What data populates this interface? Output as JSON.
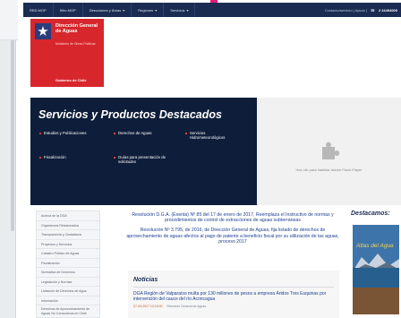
{
  "colors": {
    "navbar": "#1a2c52",
    "brand_red": "#d7272d",
    "banner": "#0e1d3a",
    "accent_bullet": "#e8412c",
    "link": "#1d3f8f"
  },
  "topnav": {
    "items": [
      {
        "label": "RED MOP",
        "caret": false
      },
      {
        "label": "Sitio MOP",
        "caret": false
      },
      {
        "label": "Direcciones y Áreas",
        "caret": true
      },
      {
        "label": "Regiones",
        "caret": true
      },
      {
        "label": "Servicios",
        "caret": true
      }
    ],
    "right_text": "Contacto/servicio | Ayuda |",
    "phone_icon": "phone-icon",
    "phone": "2 24494000"
  },
  "logo": {
    "title": "Dirección General de Aguas",
    "subtitle": "Ministerio de Obras Públicas",
    "gov": "Gobierno de Chile",
    "icon": "chile-star-icon"
  },
  "services": {
    "title": "Servicios y Productos Destacados",
    "items": [
      "Estudios y Publicaciones",
      "Derechos de Aguas",
      "Servicios Hidrometeorológicos",
      "Fiscalización",
      "Guías para presentación de solicitudes"
    ]
  },
  "flash": {
    "icon": "puzzle-plugin-icon",
    "text": "Haz clic para habilitar Adobe Flash Player"
  },
  "sidenav": {
    "items": [
      "Acerca de la DGA",
      "Organismos Relacionados",
      "Transparencia y Ciudadanía",
      "Proyectos y Servicios",
      "Catastro Público de Aguas",
      "Fiscalización",
      "Normativa de Derechos",
      "Legislación y Normas",
      "Licitación de Derechos de Agua",
      "Información",
      "Derechos de Aprovechamiento de Aguas No Consuntivos en Chile"
    ]
  },
  "resolutions": [
    "Resolución D.G.A. (Exenta) Nº 85 del 17 de enero de 2017, Reemplaza el Instructivo de normas y procedimientos de control de extracciones de aguas subterráneas",
    "Resolución Nº 3.795, de 2016, de Dirección General de Aguas, fija listado de derechos de aprovechamiento de aguas afectos al pago de patente a beneficio fiscal por su utilización de las aguas, proceso 2017"
  ],
  "noticias": {
    "title": "Noticias",
    "headline": "DGA Región de Valparaíso multa por 130 millones de pesos a empresa Áridos Tres Esquinas por intervención del cauce del río Aconcagua",
    "date": "07-03-2017 12:19:00",
    "source": "Dirección General de Aguas"
  },
  "destacamos": {
    "title": "Destacamos:",
    "atlas_title": "Atlas del Agua"
  }
}
